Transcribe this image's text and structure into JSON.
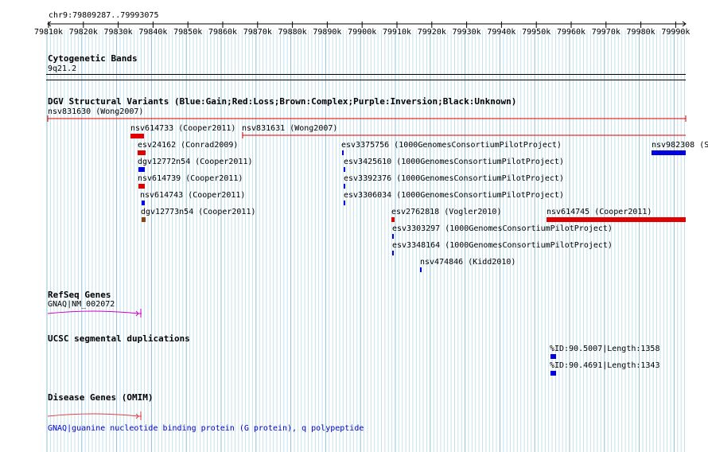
{
  "position": {
    "label": "chr9:79809287..79993075"
  },
  "ruler": {
    "ticks": [
      {
        "label": "79810k"
      },
      {
        "label": "79820k"
      },
      {
        "label": "79830k"
      },
      {
        "label": "79840k"
      },
      {
        "label": "79850k"
      },
      {
        "label": "79860k"
      },
      {
        "label": "79870k"
      },
      {
        "label": "79880k"
      },
      {
        "label": "79890k"
      },
      {
        "label": "79900k"
      },
      {
        "label": "79910k"
      },
      {
        "label": "79920k"
      },
      {
        "label": "79930k"
      },
      {
        "label": "79940k"
      },
      {
        "label": "79950k"
      },
      {
        "label": "79960k"
      },
      {
        "label": "79970k"
      },
      {
        "label": "79980k"
      },
      {
        "label": "79990k"
      }
    ]
  },
  "tracks": {
    "cytobands": {
      "title": "Cytogenetic Bands",
      "band": "9q21.2"
    },
    "dgv": {
      "title": "DGV Structural Variants (Blue:Gain;Red:Loss;Brown:Complex;Purple:Inversion;Black:Unknown)",
      "features": [
        {
          "label": "nsv831630 (Wong2007)",
          "type": "Loss",
          "color": "#e00000"
        },
        {
          "label": "nsv614733 (Cooper2011)",
          "type": "Loss",
          "color": "#e00000"
        },
        {
          "label": "nsv831631 (Wong2007)",
          "type": "Loss",
          "color": "#e00000"
        },
        {
          "label": "esv24162 (Conrad2009)",
          "type": "Loss",
          "color": "#e00000"
        },
        {
          "label": "dgv12772n54 (Cooper2011)",
          "type": "Gain",
          "color": "#0000e0"
        },
        {
          "label": "nsv614739 (Cooper2011)",
          "type": "Loss",
          "color": "#e00000"
        },
        {
          "label": "nsv614743 (Cooper2011)",
          "type": "Gain",
          "color": "#0000e0"
        },
        {
          "label": "dgv12773n54 (Cooper2011)",
          "type": "Complex",
          "color": "#8b4513"
        },
        {
          "label": "esv3375756 (1000GenomesConsortiumPilotProject)",
          "type": "Gain",
          "color": "#0000e0"
        },
        {
          "label": "esv3425610 (1000GenomesConsortiumPilotProject)",
          "type": "Gain",
          "color": "#0000e0"
        },
        {
          "label": "esv3392376 (1000GenomesConsortiumPilotProject)",
          "type": "Gain",
          "color": "#0000e0"
        },
        {
          "label": "esv3306034 (1000GenomesConsortiumPilotProject)",
          "type": "Gain",
          "color": "#0000e0"
        },
        {
          "label": "esv2762818 (Vogler2010)",
          "type": "Loss",
          "color": "#e00000"
        },
        {
          "label": "esv3303297 (1000GenomesConsortiumPilotProject)",
          "type": "Gain",
          "color": "#0000e0"
        },
        {
          "label": "esv3348164 (1000GenomesConsortiumPilotProject)",
          "type": "Gain",
          "color": "#0000e0"
        },
        {
          "label": "nsv474846 (Kidd2010)",
          "type": "Gain",
          "color": "#0000e0"
        },
        {
          "label": "nsv614745 (Cooper2011)",
          "type": "Loss",
          "color": "#e00000"
        },
        {
          "label": "nsv982308 (S",
          "type": "Gain",
          "color": "#0000e0"
        }
      ]
    },
    "refseq": {
      "title": "RefSeq Genes",
      "gene_label": "GNAQ|NM_002072",
      "color": "#cc00cc"
    },
    "segdups": {
      "title": "UCSC segmental duplications",
      "features": [
        {
          "label": "%ID:90.5007|Length:1358",
          "color": "#0000e0"
        },
        {
          "label": "%ID:90.4691|Length:1343",
          "color": "#0000e0"
        }
      ]
    },
    "omim": {
      "title": "Disease Genes (OMIM)",
      "gene_label": "GNAQ|guanine nucleotide binding protein (G protein), q polypeptide",
      "color": "#e04040",
      "label_color": "#000080"
    }
  }
}
